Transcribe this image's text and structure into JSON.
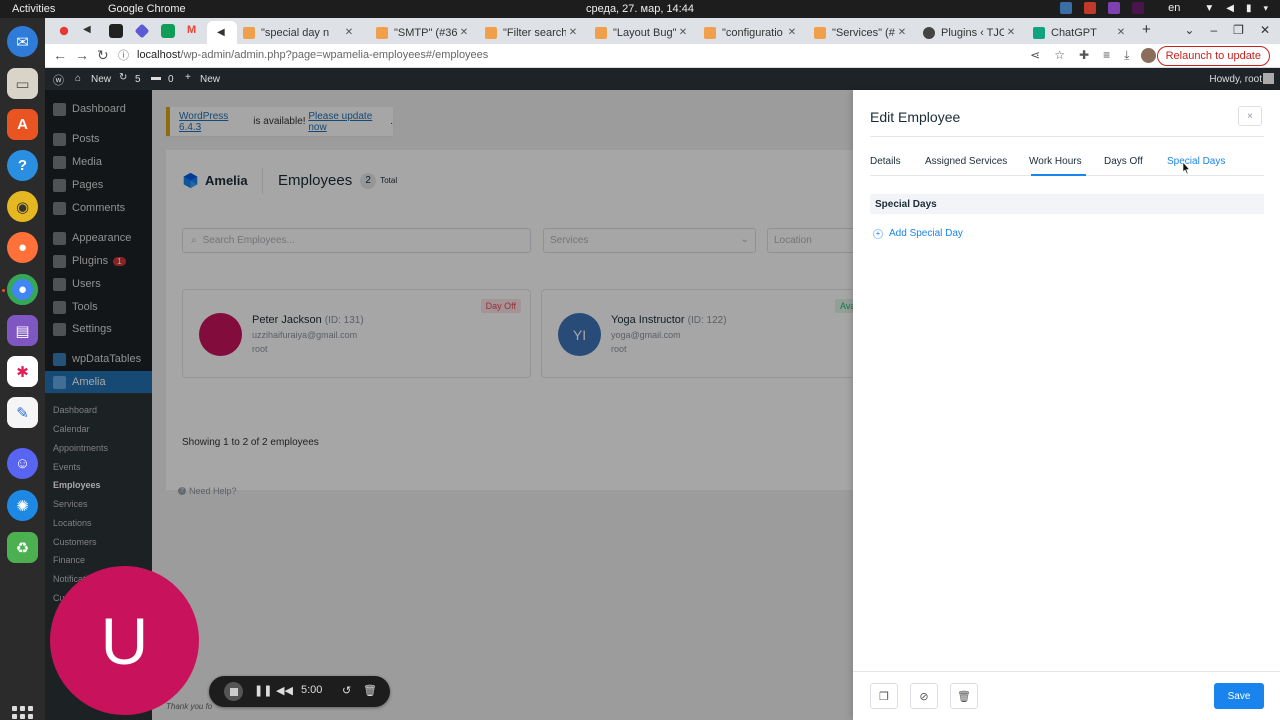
{
  "system": {
    "activities": "Activities",
    "app_name": "Google Chrome",
    "clock": "среда, 27. мар, 14:44",
    "lang": "en"
  },
  "browser": {
    "tabs": [
      {
        "label": "\"special day n",
        "color": "#f0a04b"
      },
      {
        "label": "\"SMTP\" (#360",
        "color": "#f0a04b"
      },
      {
        "label": "\"Filter search\"",
        "color": "#f0a04b"
      },
      {
        "label": "\"Layout Bug\"",
        "color": "#f0a04b"
      },
      {
        "label": "\"configuratio",
        "color": "#f0a04b"
      },
      {
        "label": "\"Services\" (#3",
        "color": "#f0a04b"
      },
      {
        "label": "Plugins ‹ TJOA",
        "color": "#444444"
      },
      {
        "label": "ChatGPT",
        "color": "#10a37f"
      }
    ],
    "url_host": "localhost",
    "url_path": "/wp-admin/admin.php?page=wpamelia-employees#/employees",
    "relaunch_label": "Relaunch to update"
  },
  "adminbar": {
    "new_site": "New",
    "updates": "5",
    "comments": "0",
    "new_label": "New",
    "howdy": "Howdy, root"
  },
  "wp_menu": {
    "dashboard": "Dashboard",
    "posts": "Posts",
    "media": "Media",
    "pages": "Pages",
    "comments": "Comments",
    "appearance": "Appearance",
    "plugins": "Plugins",
    "plugins_badge": "1",
    "users": "Users",
    "tools": "Tools",
    "settings": "Settings",
    "wpdatatables": "wpDataTables",
    "amelia": "Amelia"
  },
  "amelia_menu": [
    "Dashboard",
    "Calendar",
    "Appointments",
    "Events",
    "Employees",
    "Services",
    "Locations",
    "Customers",
    "Finance",
    "Notificati",
    "Cus"
  ],
  "notice": {
    "version_link": "WordPress 6.4.3",
    "text": " is available! ",
    "update_link": "Please update now",
    "end": "."
  },
  "amelia": {
    "logo": "Amelia",
    "page_title": "Employees",
    "count": "2",
    "total_label": "Total",
    "search_placeholder": "Search Employees...",
    "services_placeholder": "Services",
    "location_placeholder": "Location",
    "employees": [
      {
        "name": "Peter Jackson",
        "id": "(ID: 131)",
        "email": "uzzihaifuraiya@gmail.com",
        "role": "root",
        "status": "Day Off",
        "initials": ""
      },
      {
        "name": "Yoga Instructor",
        "id": "(ID: 122)",
        "email": "yoga@gmail.com",
        "role": "root",
        "status": "Ava",
        "initials": "YI"
      }
    ],
    "showing": "Showing 1 to 2 of 2 employees",
    "need_help": "Need Help?",
    "thanks": "Thank you fo"
  },
  "drawer": {
    "title": "Edit Employee",
    "close": "×",
    "tabs": [
      "Details",
      "Assigned Services",
      "Work Hours",
      "Days Off",
      "Special Days"
    ],
    "active_tab": "Special Days",
    "section_title": "Special Days",
    "add_label": "Add Special Day",
    "save_label": "Save"
  },
  "overlay": {
    "webcam_letter": "U",
    "timer": "5:00"
  },
  "colors": {
    "wp_dark": "#1d2327",
    "wp_blue": "#2271b1",
    "amelia_blue": "#1a84ee",
    "webcam": "#c8135c",
    "day_off_red": "#e64a5d",
    "available_green": "#2bb673"
  }
}
